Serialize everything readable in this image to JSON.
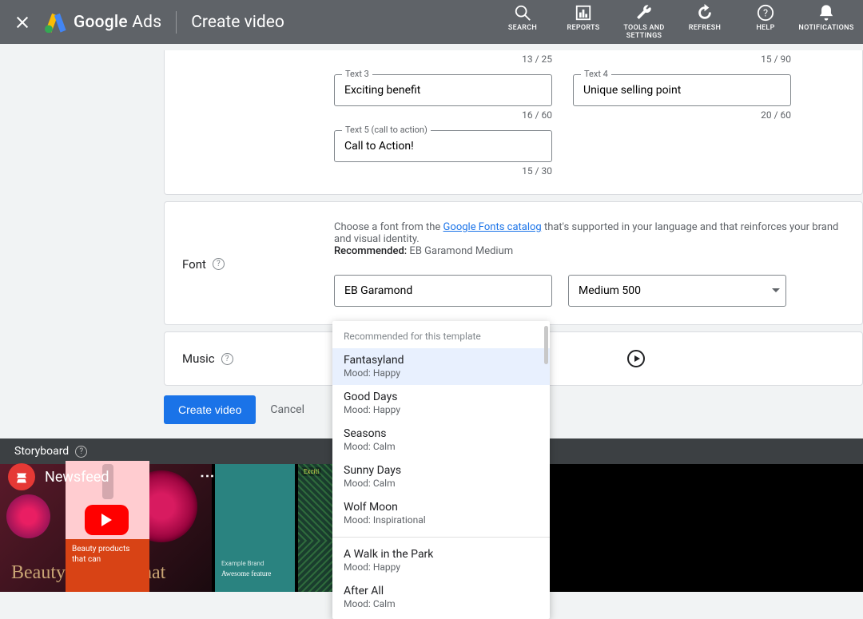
{
  "header": {
    "brand_first": "Google",
    "brand_second": "Ads",
    "title": "Create video",
    "nav": {
      "search": "SEARCH",
      "reports": "REPORTS",
      "tools": "TOOLS AND SETTINGS",
      "refresh": "REFRESH",
      "help": "HELP",
      "notifications": "NOTIFICATIONS"
    }
  },
  "texts": {
    "prev_counter_left": "13 / 25",
    "prev_counter_right": "15 / 90",
    "text3_label": "Text 3",
    "text3_value": "Exciting benefit",
    "text3_counter": "16 / 60",
    "text4_label": "Text 4",
    "text4_value": "Unique selling point",
    "text4_counter": "20 / 60",
    "text5_label": "Text 5 (call to action)",
    "text5_value": "Call to Action!",
    "text5_counter": "15 / 30"
  },
  "font": {
    "section": "Font",
    "desc_pre": "Choose a font from the ",
    "desc_link": "Google Fonts catalog",
    "desc_post": " that's supported in your language and that reinforces your brand and visual identity.",
    "recommended_label": "Recommended:",
    "recommended_value": " EB Garamond Medium",
    "family": "EB Garamond",
    "weight": "Medium 500"
  },
  "music": {
    "section": "Music",
    "dropdown_header": "Recommended for this template",
    "items": [
      {
        "name": "Fantasyland",
        "mood": "Mood: Happy",
        "selected": true
      },
      {
        "name": "Good Days",
        "mood": "Mood: Happy"
      },
      {
        "name": "Seasons",
        "mood": "Mood: Calm"
      },
      {
        "name": "Sunny Days",
        "mood": "Mood: Calm"
      },
      {
        "name": "Wolf Moon",
        "mood": "Mood: Inspirational"
      },
      {
        "name": "A Walk in the Park",
        "mood": "Mood: Happy",
        "divider_before": true
      },
      {
        "name": "After All",
        "mood": "Mood: Calm"
      }
    ]
  },
  "buttons": {
    "create": "Create video",
    "cancel": "Cancel"
  },
  "storyboard": {
    "label": "Storyboard",
    "yt_title": "Newsfeed",
    "overlay_text": "Beauty products that can",
    "thumb1_text": "Beauty…",
    "thumb1_text2": "…hat",
    "thumb2_cap": "Example Brand",
    "thumb2_text": "Awesome feature",
    "thumb3_tag": "Exciti"
  }
}
